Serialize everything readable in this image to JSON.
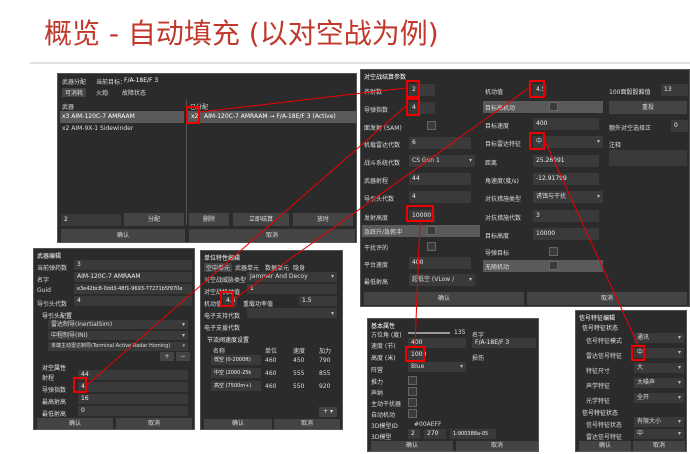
{
  "title": "概览 - 自动填充 (以对空战为例)",
  "weapon_panel": {
    "header_label": "武器分配",
    "target_label": "当前目标：",
    "target_value": "F/A-18E/F 3",
    "tabs": [
      "可消耗",
      "火炮",
      "故障状态"
    ],
    "col_weapon": "武器",
    "col_assigned": "已分配",
    "weapons": [
      "x3 AIM-120C-7 AMRAAM",
      "x2 AIM-9X-1 Sidewinder"
    ],
    "assigned_qty": "x2",
    "assigned_text": "AIM-120C-7 AMRAAM → F/A-18E/F 3 (Active)",
    "qty_value": "2",
    "btn_assign": "分配",
    "btn_delete": "删除",
    "btn_compute": "立即结算",
    "btn_release": "放时",
    "btn_ok": "确认",
    "btn_cancel": "取消"
  },
  "params_panel": {
    "header": "对空战结算参数",
    "fire_count_label": "齐射数",
    "fire_count": "2",
    "guide_label": "导弹指数",
    "guide": "4",
    "sam_label": "面发射 (SAM)",
    "radar_gen_label": "机载雷达代数",
    "radar_gen": "6",
    "sys_gen_label": "战斗系统代数",
    "sys_gen": "CS Gen 1",
    "range_label": "武器射程",
    "range": "44",
    "guide_gen_label": "导引头代数",
    "guide_gen": "4",
    "alt_label": "发射高度",
    "alt": "10000",
    "climb_label": "急跃升/急俯冲",
    "dodge_label": "干扰评的",
    "plat_speed_label": "平台速度",
    "plat_speed": "400",
    "min_alt_label": "最低射高",
    "min_alt": "超低空 (VLow /",
    "maneuver_label": "机动值",
    "maneuver": "4.5",
    "target_maneuver_label": "目标高机动",
    "target_speed_label": "目标速度",
    "target_speed": "400",
    "radar_feature_label": "目标雷达特征",
    "radar_feature": "中",
    "distance_label": "距离",
    "distance": "25.26091",
    "angle_label": "角速度(度/s)",
    "angle": "-12.91799",
    "jam_type_label": "对抗措施类型",
    "jam_type": "诱饵与干扰",
    "jam_gen_label": "对抗措施代数",
    "jam_gen": "3",
    "target_alt_label": "目标高度",
    "target_alt": "10000",
    "guided_label": "导弹目标",
    "no_maneuver_label": "无随机动",
    "hit_prob_label": "100面骰骰豁值",
    "hit_prob": "13",
    "btn_reroll": "重投",
    "extra_label": "额外对空选择正",
    "extra": "0",
    "note_label": "注释",
    "btn_ok": "确认",
    "btn_cancel": "取消"
  },
  "weapon_edit": {
    "header": "武器编辑",
    "rows": [
      [
        "当前弹药数",
        "3"
      ],
      [
        "名字",
        "AIM-120C-7 AMRAAM"
      ],
      [
        "Guid",
        "e3e42bc8-0dd3-48f1-9693-77271b5f970e"
      ],
      [
        "导引头代数",
        "4"
      ]
    ],
    "guide_section": "导引头配置",
    "guide_items": [
      "雷达制导(InertialSim)",
      "中程制导(INI)",
      "末端主动雷达制导(Terminal Active Radar Homing)"
    ],
    "attr_section": "对空属性",
    "attr_rows": [
      [
        "射程",
        "44"
      ],
      [
        "导弹指数",
        "4"
      ],
      [
        "最高射高",
        "16"
      ],
      [
        "最低射高",
        "0"
      ]
    ],
    "btn_ok": "确认",
    "btn_cancel": "取消"
  },
  "platform_edit": {
    "header": "单位特性编辑",
    "tabs": [
      "空中单元",
      "武器单元",
      "数据单元",
      "隐身"
    ],
    "rows": [
      [
        "对空战威胁类型",
        "Jammer And Decoy"
      ],
      [
        "对空战机动值",
        "1"
      ],
      [
        "机动值",
        "4.5"
      ],
      [
        "重载功率值",
        "1.5"
      ],
      [
        "电子支持代数",
        ""
      ]
    ],
    "table_title": "节流阀速度设置",
    "cols": [
      "名称",
      "单位",
      "速度",
      "加力"
    ],
    "table_rows": [
      [
        "低空 (0-2000ft)",
        "460",
        "450",
        "790"
      ],
      [
        "中空 (2000-25k",
        "460",
        "555",
        "855"
      ],
      [
        "高空 (7500m+)",
        "460",
        "550",
        "920"
      ]
    ],
    "btn_ok": "确认",
    "btn_cancel": "取消"
  },
  "unit_edit": {
    "header": "基本属性",
    "rows": [
      [
        "方位角 (度)",
        "135"
      ],
      [
        "速度 (节)",
        "400"
      ],
      [
        "高度 (米)",
        "10000"
      ],
      [
        "阵营",
        "Blue"
      ]
    ],
    "flags": [
      "推力",
      "声纳",
      "主动干扰器",
      "自动机动"
    ],
    "id_label": "3D模型ID",
    "id_value": "#00AEFF",
    "model_label": "3D模型",
    "color_label": "3D颜色",
    "coord_x": "2",
    "coord_y": "270",
    "uid": "1:900388a-05",
    "name_label": "名字",
    "name_value": "F/A-18E/F 3",
    "damage_label": "损伤",
    "btn_ok": "确认",
    "btn_cancel": "取消"
  },
  "signature_edit": {
    "header": "信号特征编辑",
    "sec1": "信号特征状态",
    "rows1": [
      [
        "信号特征模式",
        "通讯"
      ],
      [
        "雷达信号特征",
        "中"
      ],
      [
        "特征尺寸",
        "大"
      ],
      [
        "声学特征",
        "大噪声"
      ],
      [
        "光学特征",
        "全开"
      ]
    ],
    "sec2": "信号特征状态",
    "rows2": [
      [
        "信号特征状态",
        "有限大小"
      ],
      [
        "雷达信号特征",
        "中"
      ]
    ],
    "btn_ok": "确认",
    "btn_cancel": "取消"
  }
}
